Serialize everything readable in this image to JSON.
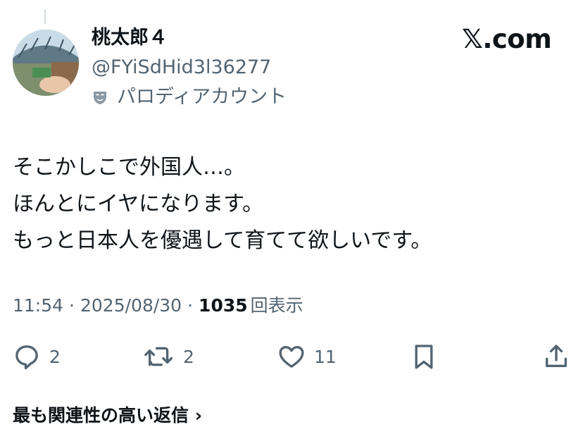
{
  "author": {
    "name": "桃太郎４",
    "handle": "@FYiSdHid3l36277",
    "label": "パロディアカウント"
  },
  "brand": {
    "logo_text": ".com",
    "logo_mark": "𝕏"
  },
  "post": {
    "lines": [
      "そこかしこで外国人…。",
      "ほんとにイヤになります。",
      "もっと日本人を優遇して育てて欲しいです。"
    ]
  },
  "meta": {
    "time": "11:54",
    "separator": "·",
    "date": "2025/08/30",
    "views": "1035",
    "views_label": "回表示"
  },
  "actions": {
    "reply_count": "2",
    "repost_count": "2",
    "like_count": "11"
  },
  "next_section": {
    "title": "最も関連性の高い返信 ›"
  },
  "icons": [
    "reply-icon",
    "repost-icon",
    "like-icon",
    "bookmark-icon",
    "share-icon",
    "parody-mask-icon"
  ]
}
